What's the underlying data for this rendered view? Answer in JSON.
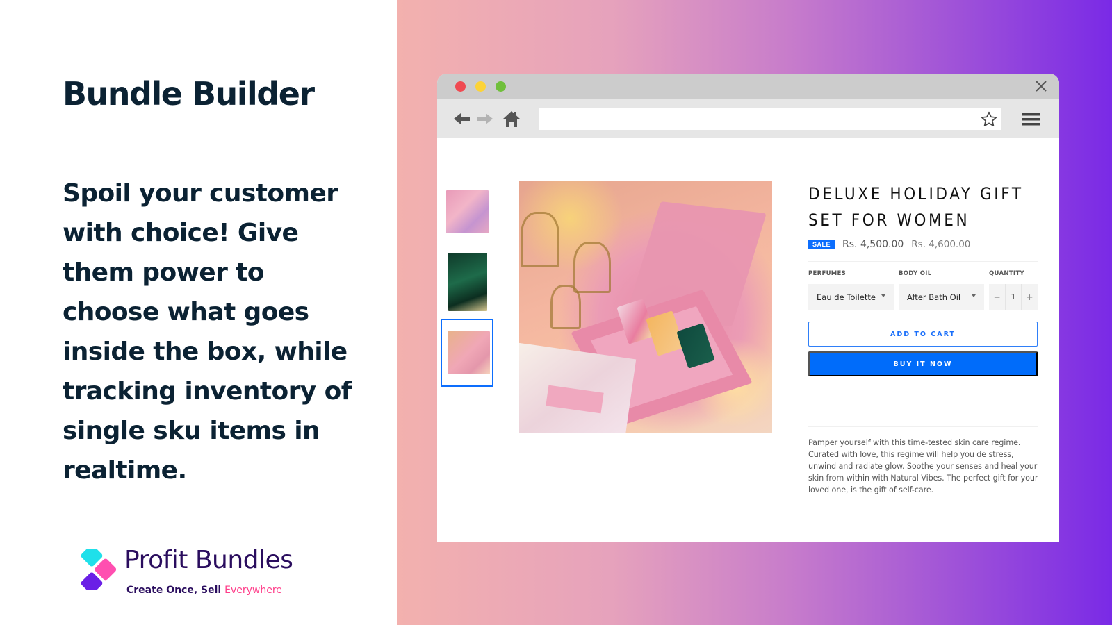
{
  "left": {
    "headline": "Bundle Builder",
    "tagline": "Spoil your customer with choice! Give them power to choose what goes inside the box, while tracking inventory of single sku items in realtime.",
    "logo": {
      "name": "Profit Bundles",
      "sub_prefix": "Create Once, Sell ",
      "sub_accent": "Everywhere",
      "colors": {
        "cyan": "#1fe0ea",
        "pink": "#ff4fb0",
        "purple": "#6a1fe6",
        "text": "#2a0d5e",
        "accent": "#ff3e8a"
      }
    }
  },
  "browser": {
    "controls": [
      "close",
      "minimize",
      "maximize"
    ],
    "toolbar": {
      "icons": [
        "back-arrow-icon",
        "forward-arrow-icon",
        "home-icon",
        "star-icon",
        "hamburger-menu-icon"
      ],
      "url_value": ""
    }
  },
  "product": {
    "thumbnails": [
      "Gift sets on pink background",
      "Green gift box with perfume",
      "Pink gift box with soaps"
    ],
    "selected_thumbnail": 3,
    "title": "Deluxe Holiday Gift Set for Women",
    "badge": "SALE",
    "price": "Rs. 4,500.00",
    "compare_price": "Rs. 4,600.00",
    "options": [
      {
        "label": "PERFUMES",
        "value": "Eau de Toilette"
      },
      {
        "label": "BODY OIL",
        "value": "After Bath Oil"
      }
    ],
    "quantity": {
      "label": "QUANTITY",
      "minus": "−",
      "value": "1",
      "plus": "+"
    },
    "add_to_cart": "ADD TO CART",
    "buy_now": "BUY IT NOW",
    "description": "Pamper yourself with this time-tested skin care regime. Curated with love, this regime will help you de stress, unwind and radiate glow. Soothe your senses and heal your skin from within with Natural Vibes. The perfect gift for your loved one, is the gift of self-care.",
    "colors": {
      "primary": "#006cfa",
      "sale_badge": "#0d6efd"
    }
  }
}
